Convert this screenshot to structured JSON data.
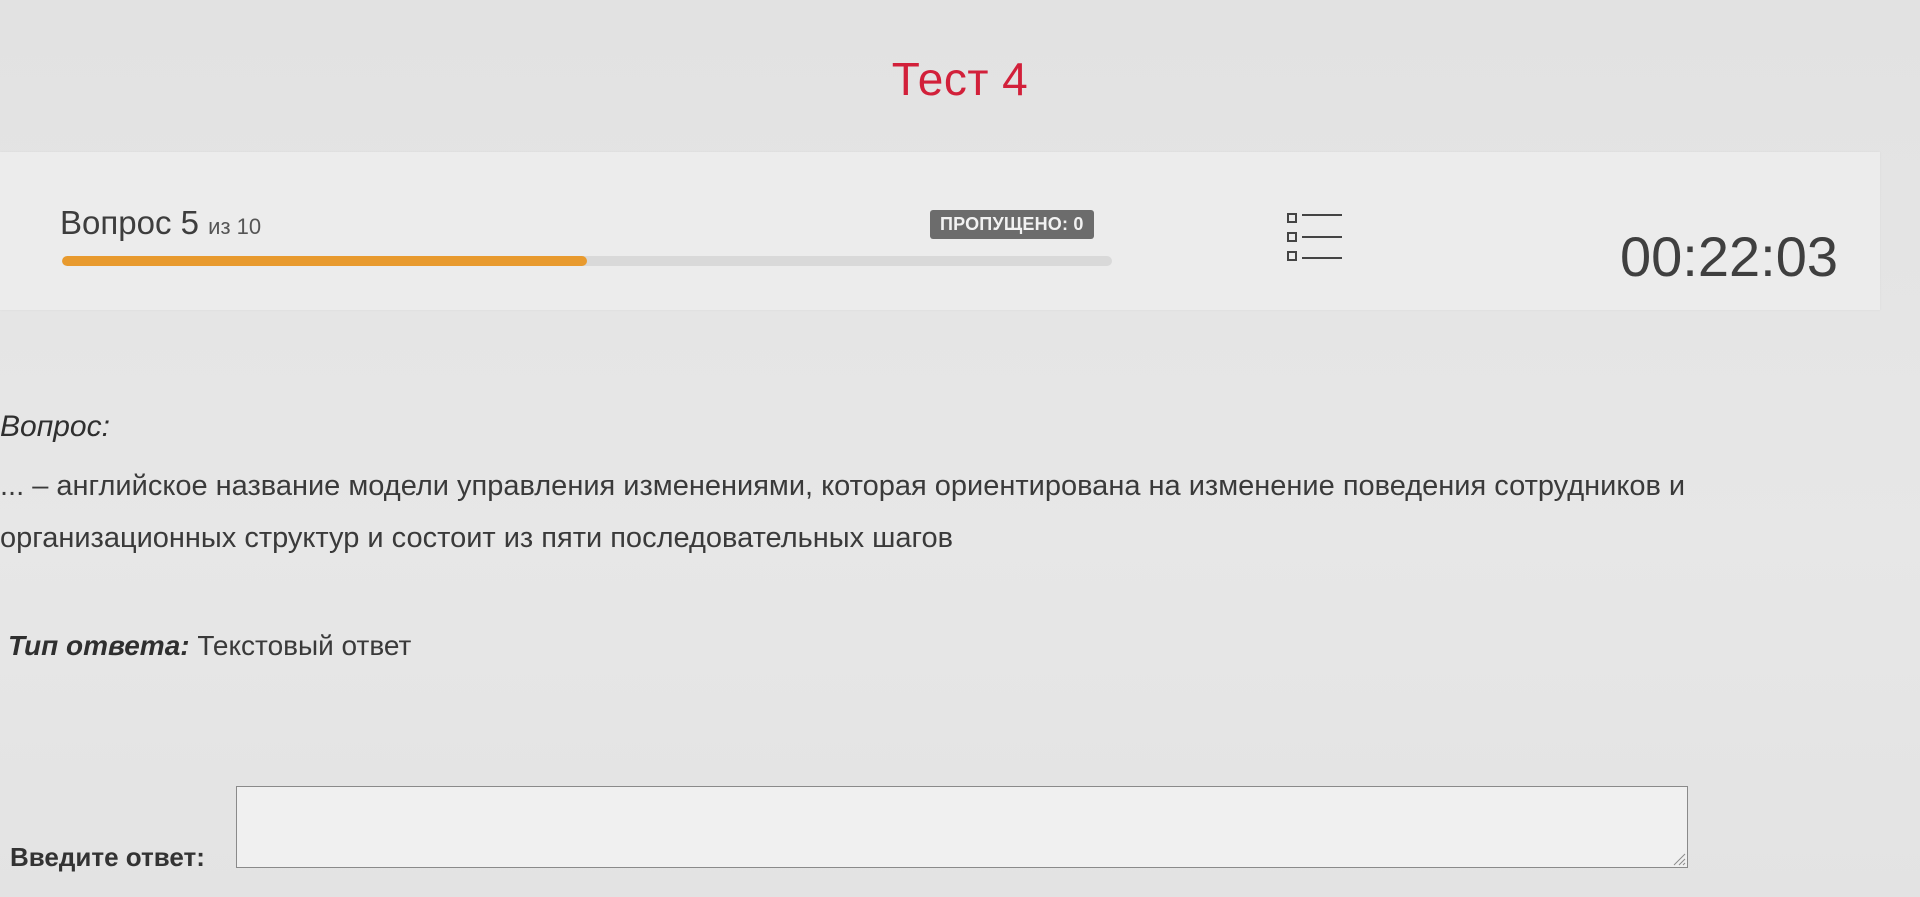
{
  "header": {
    "title": "Тест 4",
    "title_color": "#d2203a"
  },
  "status_bar": {
    "question_word": "Вопрос",
    "current_question": "5",
    "of_total": "из 10",
    "progress_fraction": 0.5,
    "progress_color": "#e89a2e",
    "skipped_label": "ПРОПУЩЕНО: 0",
    "questions_list_icon": "list-icon",
    "timer": "00:22:03"
  },
  "question": {
    "label": "Вопрос:",
    "text": "... – английское название модели управления изменениями, которая ориентирована на изменение поведения сотрудников и организационных структур и состоит из пяти последовательных шагов"
  },
  "answer_type": {
    "label": "Тип ответа:",
    "value": "Текстовый ответ"
  },
  "answer": {
    "label": "Введите ответ:",
    "value": "",
    "resize_icon": "resize-grip-icon"
  }
}
